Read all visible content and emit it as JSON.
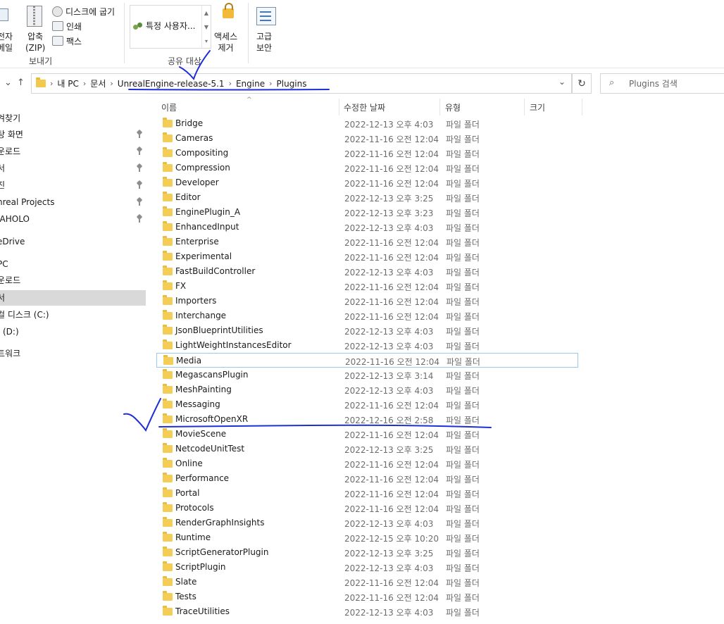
{
  "ribbon": {
    "send_group": {
      "email_label": "전자\n메일",
      "zip_label": "압축\n(ZIP)",
      "burn_label": "디스크에 굽기",
      "print_label": "인쇄",
      "fax_label": "팩스",
      "group_label": "보내기"
    },
    "share_group": {
      "share_item": "특정 사용자...",
      "remove_access_label": "액세스\n제거",
      "group_label": "공유 대상"
    },
    "security_group": {
      "advanced_security_label": "고급\n보안"
    }
  },
  "address_bar": {
    "crumbs": [
      "내 PC",
      "문서",
      "UnrealEngine-release-5.1",
      "Engine",
      "Plugins"
    ]
  },
  "search": {
    "placeholder": "Plugins 검색"
  },
  "nav_pane": {
    "items": [
      {
        "label": "겨찾기"
      },
      {
        "label": "탕 화면"
      },
      {
        "label": "운로드"
      },
      {
        "label": "서"
      },
      {
        "label": "진"
      },
      {
        "label": "nreal Projects"
      },
      {
        "label": "IAHOLO"
      },
      {
        "label": "eDrive"
      },
      {
        "label": "PC"
      },
      {
        "label": "운로드"
      },
      {
        "label": "서"
      },
      {
        "label": "컬 디스크 (C:)"
      },
      {
        "label": "(D:)"
      },
      {
        "label": "트워크"
      }
    ]
  },
  "columns": {
    "name": "이름",
    "modified": "수정한 날짜",
    "type": "유형",
    "size": "크기"
  },
  "files": [
    {
      "name": "Bridge",
      "date": "2022-12-13 오후 4:03",
      "type": "파일 폴더"
    },
    {
      "name": "Cameras",
      "date": "2022-11-16 오전 12:04",
      "type": "파일 폴더"
    },
    {
      "name": "Compositing",
      "date": "2022-11-16 오전 12:04",
      "type": "파일 폴더"
    },
    {
      "name": "Compression",
      "date": "2022-11-16 오전 12:04",
      "type": "파일 폴더"
    },
    {
      "name": "Developer",
      "date": "2022-11-16 오전 12:04",
      "type": "파일 폴더"
    },
    {
      "name": "Editor",
      "date": "2022-12-13 오후 3:25",
      "type": "파일 폴더"
    },
    {
      "name": "EnginePlugin_A",
      "date": "2022-12-13 오후 3:23",
      "type": "파일 폴더"
    },
    {
      "name": "EnhancedInput",
      "date": "2022-12-13 오후 4:03",
      "type": "파일 폴더"
    },
    {
      "name": "Enterprise",
      "date": "2022-11-16 오전 12:04",
      "type": "파일 폴더"
    },
    {
      "name": "Experimental",
      "date": "2022-11-16 오전 12:04",
      "type": "파일 폴더"
    },
    {
      "name": "FastBuildController",
      "date": "2022-12-13 오후 4:03",
      "type": "파일 폴더"
    },
    {
      "name": "FX",
      "date": "2022-11-16 오전 12:04",
      "type": "파일 폴더"
    },
    {
      "name": "Importers",
      "date": "2022-11-16 오전 12:04",
      "type": "파일 폴더"
    },
    {
      "name": "Interchange",
      "date": "2022-11-16 오전 12:04",
      "type": "파일 폴더"
    },
    {
      "name": "JsonBlueprintUtilities",
      "date": "2022-12-13 오후 4:03",
      "type": "파일 폴더"
    },
    {
      "name": "LightWeightInstancesEditor",
      "date": "2022-12-13 오후 4:03",
      "type": "파일 폴더"
    },
    {
      "name": "Media",
      "date": "2022-11-16 오전 12:04",
      "type": "파일 폴더"
    },
    {
      "name": "MegascansPlugin",
      "date": "2022-12-13 오후 3:14",
      "type": "파일 폴더"
    },
    {
      "name": "MeshPainting",
      "date": "2022-12-13 오후 4:03",
      "type": "파일 폴더"
    },
    {
      "name": "Messaging",
      "date": "2022-11-16 오전 12:04",
      "type": "파일 폴더"
    },
    {
      "name": "MicrosoftOpenXR",
      "date": "2022-12-16 오전 2:58",
      "type": "파일 폴더"
    },
    {
      "name": "MovieScene",
      "date": "2022-11-16 오전 12:04",
      "type": "파일 폴더"
    },
    {
      "name": "NetcodeUnitTest",
      "date": "2022-12-13 오후 3:25",
      "type": "파일 폴더"
    },
    {
      "name": "Online",
      "date": "2022-11-16 오전 12:04",
      "type": "파일 폴더"
    },
    {
      "name": "Performance",
      "date": "2022-11-16 오전 12:04",
      "type": "파일 폴더"
    },
    {
      "name": "Portal",
      "date": "2022-11-16 오전 12:04",
      "type": "파일 폴더"
    },
    {
      "name": "Protocols",
      "date": "2022-11-16 오전 12:04",
      "type": "파일 폴더"
    },
    {
      "name": "RenderGraphInsights",
      "date": "2022-12-13 오후 4:03",
      "type": "파일 폴더"
    },
    {
      "name": "Runtime",
      "date": "2022-12-15 오후 10:20",
      "type": "파일 폴더"
    },
    {
      "name": "ScriptGeneratorPlugin",
      "date": "2022-12-13 오후 3:25",
      "type": "파일 폴더"
    },
    {
      "name": "ScriptPlugin",
      "date": "2022-12-13 오후 4:03",
      "type": "파일 폴더"
    },
    {
      "name": "Slate",
      "date": "2022-11-16 오전 12:04",
      "type": "파일 폴더"
    },
    {
      "name": "Tests",
      "date": "2022-11-16 오전 12:04",
      "type": "파일 폴더"
    },
    {
      "name": "TraceUtilities",
      "date": "2022-12-13 오후 4:03",
      "type": "파일 폴더"
    }
  ],
  "colors": {
    "annotation_ink": "#1f2fd6",
    "selection": "#d9d9d9",
    "focus_border": "#99c9ef",
    "folder": "#f4cd57"
  }
}
